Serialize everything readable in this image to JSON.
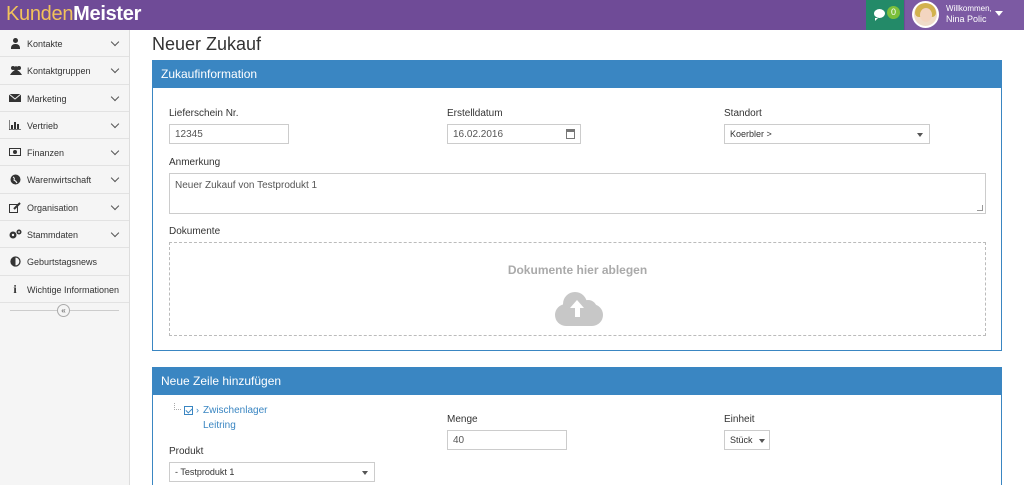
{
  "app": {
    "logo_part1": "Kunden",
    "logo_part2": "Meister",
    "chat_count": "0",
    "user_welcome": "Willkommen,",
    "user_name": "Nina Polic"
  },
  "sidebar": {
    "items": [
      {
        "label": "Kontakte",
        "icon": "person-icon"
      },
      {
        "label": "Kontaktgruppen",
        "icon": "group-icon"
      },
      {
        "label": "Marketing",
        "icon": "envelope-icon"
      },
      {
        "label": "Vertrieb",
        "icon": "bar-chart-icon"
      },
      {
        "label": "Finanzen",
        "icon": "money-icon"
      },
      {
        "label": "Warenwirtschaft",
        "icon": "globe-icon"
      },
      {
        "label": "Organisation",
        "icon": "edit-icon"
      },
      {
        "label": "Stammdaten",
        "icon": "gears-icon"
      },
      {
        "label": "Geburtstagsnews",
        "icon": "half-circle-icon"
      },
      {
        "label": "Wichtige Informationen",
        "icon": "info-icon"
      }
    ],
    "collapse_glyph": "«"
  },
  "page": {
    "title": "Neuer Zukauf"
  },
  "purchase_panel": {
    "title": "Zukaufinformation",
    "delivery_note_label": "Lieferschein Nr.",
    "delivery_note_value": "12345",
    "date_label": "Erstelldatum",
    "date_value": "16.02.2016",
    "location_label": "Standort",
    "location_value": "Koerbler >",
    "note_label": "Anmerkung",
    "note_value": "Neuer Zukauf von Testprodukt 1",
    "documents_label": "Dokumente",
    "dropzone_text": "Dokumente hier ablegen"
  },
  "line_panel": {
    "title": "Neue Zeile hinzufügen",
    "tree_node_line1": "Zwischenlager",
    "tree_node_line2": "Leitring",
    "product_label": "Produkt",
    "product_value": "- Testprodukt 1",
    "quantity_label": "Menge",
    "quantity_value": "40",
    "unit_label": "Einheit",
    "unit_value": "Stück"
  },
  "colors": {
    "topbar": "#6f4b97",
    "panel_header": "#3a86c2",
    "chat_bg": "#238a68",
    "logo_accent": "#f2c25a"
  }
}
